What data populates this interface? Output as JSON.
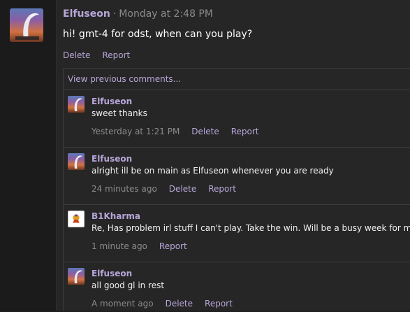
{
  "post": {
    "author": "Elfuseon",
    "separator": "·",
    "timestamp": "Monday at 2:48 PM",
    "body": "hi! gmt-4 for odst, when can you play?",
    "actions": {
      "delete": "Delete",
      "report": "Report"
    }
  },
  "comments": {
    "view_previous": "View previous comments...",
    "items": [
      {
        "author": "Elfuseon",
        "text": "sweet thanks",
        "time": "Yesterday at 1:21 PM",
        "delete": "Delete",
        "report": "Report"
      },
      {
        "author": "Elfuseon",
        "text": "alright ill be on main as Elfuseon whenever you are ready",
        "time": "24 minutes ago",
        "delete": "Delete",
        "report": "Report"
      },
      {
        "author": "B1Kharma",
        "text": "Re, Has problem irl stuff I can't play. Take the win. Will be a busy week for me",
        "time": "1 minute ago",
        "report": "Report"
      },
      {
        "author": "Elfuseon",
        "text": "all good gl in rest",
        "time": "A moment ago",
        "delete": "Delete",
        "report": "Report"
      }
    ]
  },
  "colors": {
    "accent": "#b7a6d8",
    "muted": "#8b8b8b",
    "background": "#262626"
  }
}
